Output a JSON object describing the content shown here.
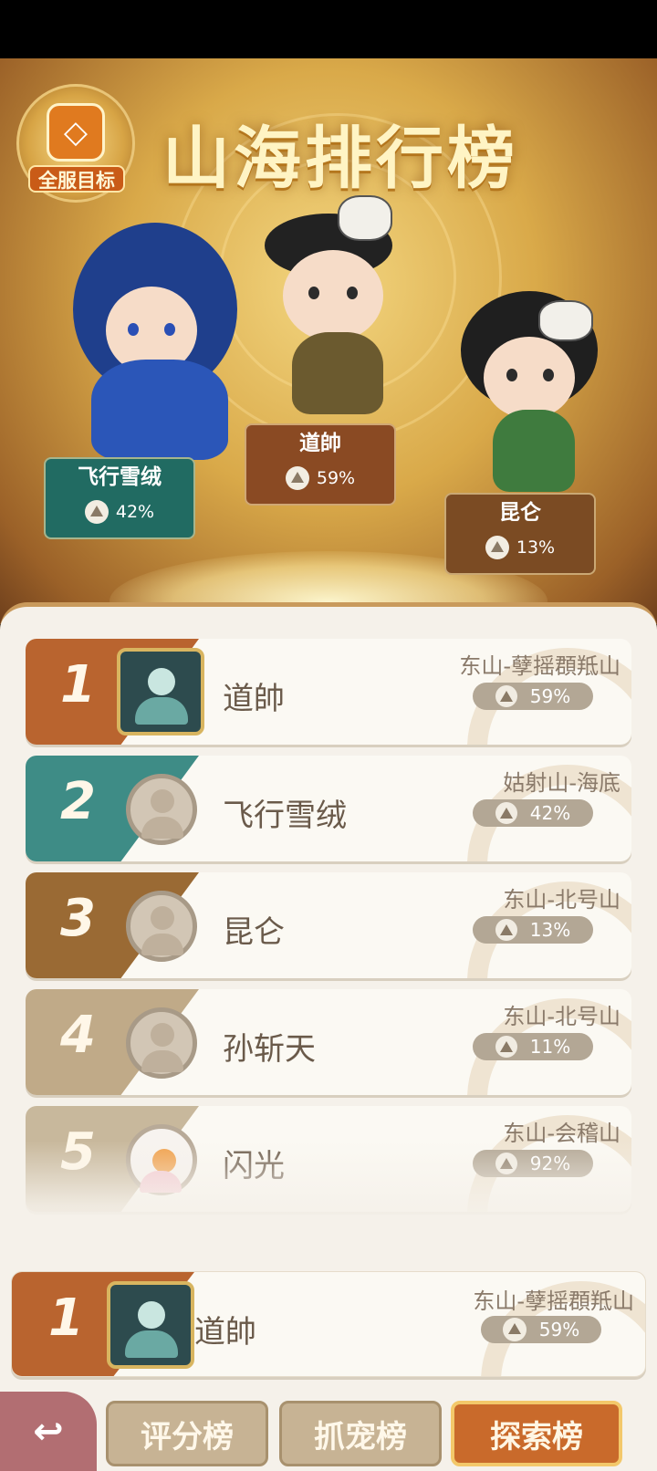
{
  "header": {
    "title": "山海排行榜",
    "badge_label": "全服目标"
  },
  "podium": [
    {
      "name": "飞行雪绒",
      "percent": "42%",
      "color": "#216b62"
    },
    {
      "name": "道帥",
      "percent": "59%",
      "color": "#8a4a23"
    },
    {
      "name": "昆仑",
      "percent": "13%",
      "color": "#7b4b23"
    }
  ],
  "rankings": [
    {
      "rank": "1",
      "name": "道帥",
      "server": "东山-孽摇頵羝山",
      "percent": "59%",
      "rank_color": "#b9642f"
    },
    {
      "rank": "2",
      "name": "飞行雪绒",
      "server": "姑射山-海底",
      "percent": "42%",
      "rank_color": "#3e8c86"
    },
    {
      "rank": "3",
      "name": "昆仑",
      "server": "东山-北号山",
      "percent": "13%",
      "rank_color": "#9a6a34"
    },
    {
      "rank": "4",
      "name": "孙斩天",
      "server": "东山-北号山",
      "percent": "11%",
      "rank_color": "#c0aa88"
    },
    {
      "rank": "5",
      "name": "闪光",
      "server": "东山-会稽山",
      "percent": "92%",
      "rank_color": "#c8b89c"
    }
  ],
  "my_rank": {
    "rank": "1",
    "name": "道帥",
    "server": "东山-孽摇頵羝山",
    "percent": "59%"
  },
  "tabs": {
    "back_icon": "↩",
    "items": [
      {
        "label": "评分榜",
        "active": false
      },
      {
        "label": "抓宠榜",
        "active": false
      },
      {
        "label": "探索榜",
        "active": true
      }
    ]
  }
}
